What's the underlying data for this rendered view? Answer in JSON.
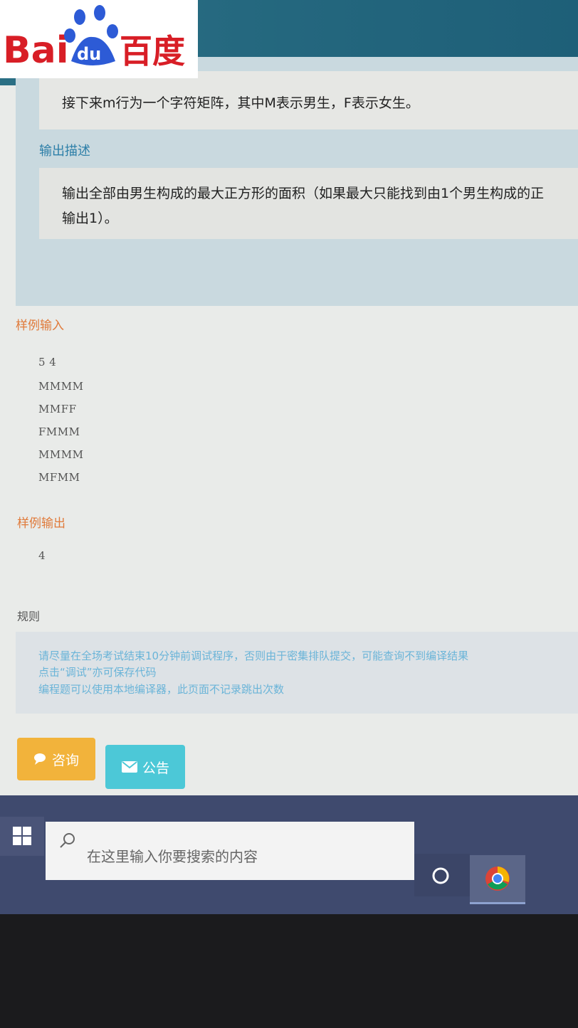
{
  "logo": {
    "text_left": "Bai",
    "paw": "du",
    "text_right": "百度"
  },
  "problem": {
    "input_line": "接下来m行为一个字符矩阵，其中M表示男生，F表示女生。",
    "output_label": "输出描述",
    "output_line1": "输出全部由男生构成的最大正方形的面积（如果最大只能找到由1个男生构成的正",
    "output_line2": "输出1）。"
  },
  "sample_input": {
    "label": "样例输入",
    "lines": [
      "5 4",
      "MMMM",
      "MMFF",
      "FMMM",
      "MMMM",
      "MFMM"
    ]
  },
  "sample_output": {
    "label": "样例输出",
    "value": "4"
  },
  "rules": {
    "label": "规则",
    "line1": "请尽量在全场考试结束10分钟前调试程序，否则由于密集排队提交，可能查询不到编译结果",
    "line2": "点击“调试”亦可保存代码",
    "line3": "编程题可以使用本地编译器，此页面不记录跳出次数"
  },
  "buttons": {
    "consult": "咨询",
    "notice": "公告"
  },
  "taskbar": {
    "search_placeholder": "在这里输入你要搜索的内容"
  },
  "colors": {
    "orange": "#e07a3a",
    "blue_label": "#2d7fa8",
    "consult": "#f2b33b",
    "notice": "#4cc8d7",
    "taskbar": "#3f4a6e"
  }
}
